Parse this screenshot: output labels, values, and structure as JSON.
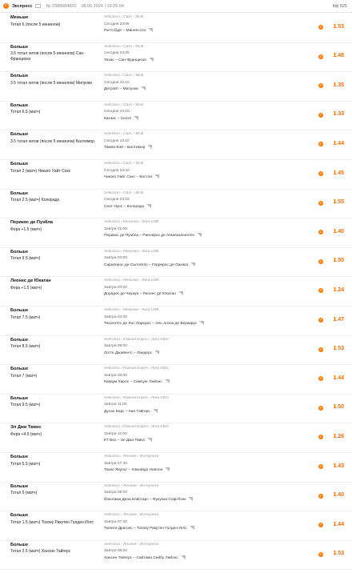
{
  "header": {
    "type": "Экспресс",
    "bet_number": "№ 2388984820",
    "datetime": "08.06.2024 | 19:25:04",
    "coef": "Кф 825"
  },
  "bets": [
    {
      "bet": "Меньше",
      "market": "Тотал 6 (после 5 иннингов)",
      "crumbs": "Selection › США › MLB",
      "time": "Сегодня 23:05",
      "teams": "Питтсбург – Миннесота",
      "odds": "1.53"
    },
    {
      "bet": "Больше",
      "market": "3.5 тотал хитов (после 5 иннингов) Сан-Франциско",
      "crumbs": "Selection › США › MLB",
      "time": "Сегодня 23:05",
      "teams": "Техас – Сан-Франциско",
      "odds": "1.48"
    },
    {
      "bet": "Больше",
      "market": "3.5 тотал хитов (после 5 иннингов) Милуоки",
      "crumbs": "Selection › США › MLB",
      "time": "Сегодня 23:10",
      "teams": "Детройт – Милуоки",
      "odds": "1.35"
    },
    {
      "bet": "Больше",
      "market": "Тотал 6.5 (матч)",
      "crumbs": "Selection › США › MLB",
      "time": "Сегодня 23:10",
      "teams": "Канзас – Сиэтл",
      "odds": "1.33"
    },
    {
      "bet": "Больше",
      "market": "3.5 тотал хитов (после 5 иннингов) Балтимор",
      "crumbs": "Selection › США › MLB",
      "time": "Сегодня 23:10",
      "teams": "Тампа-Бэй – Балтимор",
      "odds": "1.44"
    },
    {
      "bet": "Больше",
      "market": "Тотал 2 (матч) Чикаго Уайт Сокс",
      "crumbs": "Selection › США › MLB",
      "time": "Сегодня 23:10",
      "teams": "Чикаго Уайт Сокс – Бостон",
      "odds": "1.45"
    },
    {
      "bet": "Больше",
      "market": "Тотал 2.5 (матч) Колорадо",
      "crumbs": "Selection › США › MLB",
      "time": "Сегодня 23:15",
      "teams": "Сент-Луис – Колорадо",
      "odds": "1.55"
    },
    {
      "bet": "Перикос де Пуэбла",
      "market": "Фора +1.5 (матч)",
      "crumbs": "Selection › Мексика › Лига LMB",
      "time": "Завтра 01:00",
      "teams": "Перикос де Пуэбла – Риелерос де Агваскальентес",
      "odds": "1.40"
    },
    {
      "bet": "Больше",
      "market": "Тотал 9.5 (матч)",
      "crumbs": "Selection › Мексика › Лига LMB",
      "time": "Завтра 03:00",
      "teams": "Сараперос де Салтилло – Геррерос де Оахака",
      "odds": "1.50"
    },
    {
      "bet": "Леонес де Юкатан",
      "market": "Фора +1.5 (матч)",
      "crumbs": "Selection › Мексика › Лига LMB",
      "time": "Завтра 03:00",
      "teams": "Дорадос де Чиуауа – Леонес де Юкатан",
      "odds": "1.24"
    },
    {
      "bet": "Больше",
      "market": "Тотал 7.5 (матч)",
      "crumbs": "Selection › Мексика › Лига LMB",
      "time": "Завтра 03:30",
      "teams": "Текзлотес де Лос Ларедос – Эль Агила де Веракрус",
      "odds": "1.47"
    },
    {
      "bet": "Больше",
      "market": "Тотал 8.5 (матч)",
      "crumbs": "Selection › Южная Корея › Лига KBO",
      "time": "Завтра 08:00",
      "teams": "Лотте Джайентс – Ландерс",
      "odds": "1.53"
    },
    {
      "bet": "Больше",
      "market": "Тотал 7 (матч)",
      "crumbs": "Selection › Южная Корея › Лига KBO",
      "time": "Завтра 08:00",
      "teams": "Киваум Хирос – Самсунг Лайонс",
      "odds": "1.44"
    },
    {
      "bet": "Больше",
      "market": "Тотал 9.5 (матч)",
      "crumbs": "Selection › Южная Корея › Лига KBO",
      "time": "Завтра 11:00",
      "teams": "Дусан Бирс – Кая Тайгерс",
      "odds": "1.50"
    },
    {
      "bet": "Эл Джи Твинс",
      "market": "Фора +4.5 (матч)",
      "crumbs": "Selection › Южная Корея › Лига KBO",
      "time": "Завтра 11:00",
      "teams": "КТ Виз – Эл Джи Твинс",
      "odds": "1.26"
    },
    {
      "bet": "Больше",
      "market": "Тотал 5.5 (матч)",
      "crumbs": "Selection › Япония › Интерлига",
      "time": "Завтра 07:30",
      "teams": "Токио Якульт – Хоккайдо Ниппон",
      "odds": "1.43"
    },
    {
      "bet": "Больше",
      "market": "Тотал 5 (матч)",
      "crumbs": "Selection › Япония › Интерлига",
      "time": "Завтра 08:00",
      "teams": "Йокогама Дена Бэйстарс – Фукуока Софтбэнк",
      "odds": "1.40"
    },
    {
      "bet": "Больше",
      "market": "Тотал 1.5 (матч) Тохоку Ракутен Голден Иглс",
      "crumbs": "Selection › Япония › Интерлига",
      "time": "Завтра 07:30",
      "teams": "Тюнити Драгонс – Тохоку Ракутен Голден Иглс",
      "odds": "1.44"
    },
    {
      "bet": "Больше",
      "market": "Тотал 2.5 (матч) Хансин Тайгерс",
      "crumbs": "Selection › Япония › Интерлига",
      "time": "Завтра 08:00",
      "teams": "Хансин Тайгерс – Сайтама Сейбу Лайонс",
      "odds": "1.53"
    }
  ]
}
